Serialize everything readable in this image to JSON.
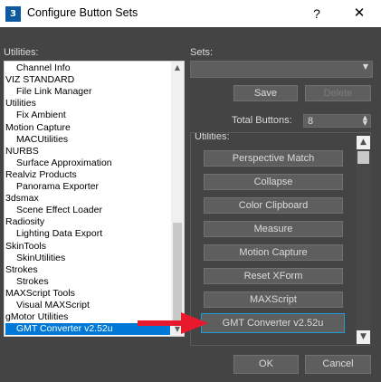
{
  "window": {
    "title": "Configure Button Sets",
    "app_icon": "3",
    "help_glyph": "?",
    "close_glyph": "✕"
  },
  "utilities_label": "Utilities:",
  "sets_label": "Sets:",
  "utilities_list": [
    {
      "label": "Channel Info",
      "sub": true
    },
    {
      "label": "VIZ STANDARD",
      "sub": false
    },
    {
      "label": "File Link Manager",
      "sub": true
    },
    {
      "label": "Utilities",
      "sub": false
    },
    {
      "label": "Fix Ambient",
      "sub": true
    },
    {
      "label": "Motion Capture",
      "sub": false
    },
    {
      "label": "MACUtilities",
      "sub": true
    },
    {
      "label": "NURBS",
      "sub": false
    },
    {
      "label": "Surface Approximation",
      "sub": true
    },
    {
      "label": "Realviz Products",
      "sub": false
    },
    {
      "label": "Panorama Exporter",
      "sub": true
    },
    {
      "label": "3dsmax",
      "sub": false
    },
    {
      "label": "Scene Effect Loader",
      "sub": true
    },
    {
      "label": "Radiosity",
      "sub": false
    },
    {
      "label": "Lighting Data Export",
      "sub": true
    },
    {
      "label": "SkinTools",
      "sub": false
    },
    {
      "label": "SkinUtilities",
      "sub": true
    },
    {
      "label": "Strokes",
      "sub": false
    },
    {
      "label": "Strokes",
      "sub": true
    },
    {
      "label": "MAXScript Tools",
      "sub": false
    },
    {
      "label": "Visual MAXScript",
      "sub": true
    },
    {
      "label": "gMotor Utilities",
      "sub": false
    },
    {
      "label": "GMT Converter v2.52u",
      "sub": true,
      "selected": true
    }
  ],
  "sets": {
    "save_label": "Save",
    "delete_label": "Delete",
    "total_buttons_label": "Total Buttons:",
    "total_buttons_value": "8",
    "utilities_label": "Utilities:",
    "buttons": [
      "Perspective Match",
      "Collapse",
      "Color Clipboard",
      "Measure",
      "Motion Capture",
      "Reset XForm",
      "MAXScript",
      "GMT Converter v2.52u"
    ]
  },
  "footer": {
    "ok_label": "OK",
    "cancel_label": "Cancel"
  },
  "colors": {
    "background": "#444444",
    "selection": "#0078d7",
    "arrow": "#e8192c",
    "highlight_border": "#1f9bd6"
  },
  "icons": [
    "app-icon",
    "help-icon",
    "close-icon",
    "chevron-down-icon",
    "spinner-icon",
    "arrow-icon"
  ]
}
